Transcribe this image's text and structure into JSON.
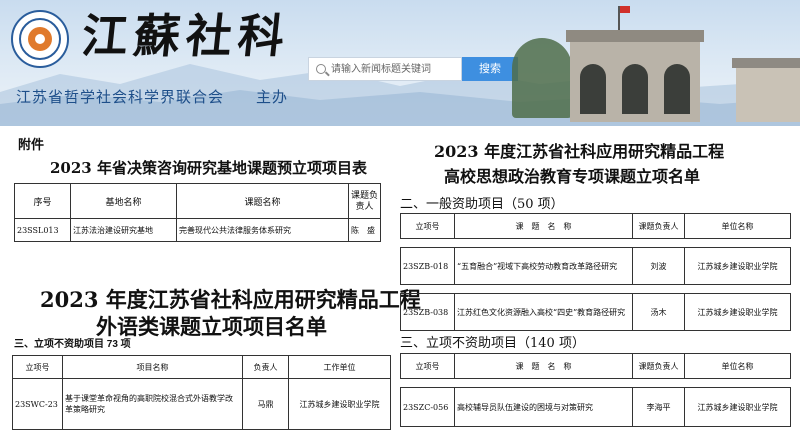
{
  "header": {
    "brand": "江蘇社科",
    "org_line": "江苏省哲学社会科学界联合会　　主办",
    "search": {
      "placeholder": "请输入新闻标题关键词",
      "button": "搜索"
    }
  },
  "left_doc": {
    "attachment_label": "附件",
    "table_a_title": "2023 年省决策咨询研究基地课题预立项项目表",
    "table_a": {
      "headers": [
        "序号",
        "基地名称",
        "课题名称",
        "课题负责人"
      ],
      "rows": [
        [
          "23SSL013",
          "江苏法治建设研究基地",
          "完善现代公共法律服务体系研究",
          "陈　盛"
        ]
      ]
    },
    "title_line1": "2023 年度江苏省社科应用研究精品工程",
    "title_line2": "外语类课题立项项目名单",
    "section": "三、立项不资助项目 73 项",
    "table_b": {
      "headers": [
        "立项号",
        "项目名称",
        "负责人",
        "工作单位"
      ],
      "rows": [
        [
          "23SWC-23",
          "基于课堂革命视角的高职院校混合式外语教学改革策略研究",
          "马鼎",
          "江苏城乡建设职业学院"
        ]
      ]
    }
  },
  "right_doc": {
    "title_line1": "2023 年度江苏省社科应用研究精品工程",
    "title_line2": "高校思想政治教育专项课题立项名单",
    "section1": "二、一般资助项目（50 项）",
    "table_c": {
      "headers": [
        "立项号",
        "课　题　名　称",
        "课题负责人",
        "单位名称"
      ],
      "rows": [
        [
          "23SZB-018",
          "“五育融合”视域下高校劳动教育改革路径研究",
          "刘波",
          "江苏城乡建设职业学院"
        ],
        [
          "23SZB-038",
          "江苏红色文化资源融入高校“四史”教育路径研究",
          "汤木",
          "江苏城乡建设职业学院"
        ]
      ]
    },
    "section2": "三、立项不资助项目（140 项）",
    "table_d": {
      "headers": [
        "立项号",
        "课　题　名　称",
        "课题负责人",
        "单位名称"
      ],
      "rows": [
        [
          "23SZC-056",
          "高校辅导员队伍建设的困境与对策研究",
          "李海平",
          "江苏城乡建设职业学院"
        ]
      ]
    }
  }
}
